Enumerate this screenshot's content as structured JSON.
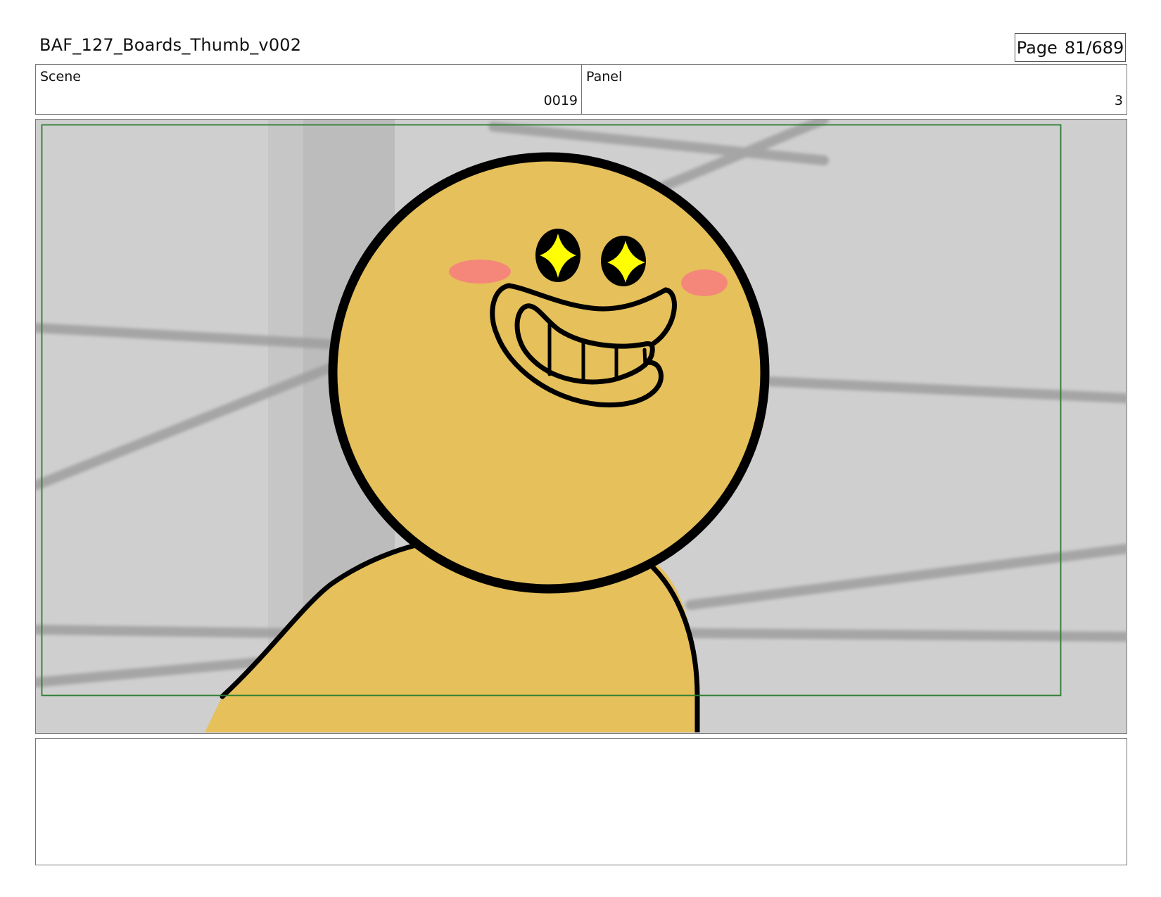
{
  "header": {
    "title": "BAF_127_Boards_Thumb_v002",
    "page_label": "Page",
    "page_value": "81/689"
  },
  "info": {
    "scene_label": "Scene",
    "scene_value": "0019",
    "panel_label": "Panel",
    "panel_value": "3"
  },
  "frame": {
    "safe_area_color": "#2e7d32",
    "background_color": "#d0d0d0",
    "character_color": "#e6c05a",
    "cheek_color": "#f4877a",
    "eye_sparkle_color": "#ffff00"
  },
  "notes": {
    "text": ""
  }
}
